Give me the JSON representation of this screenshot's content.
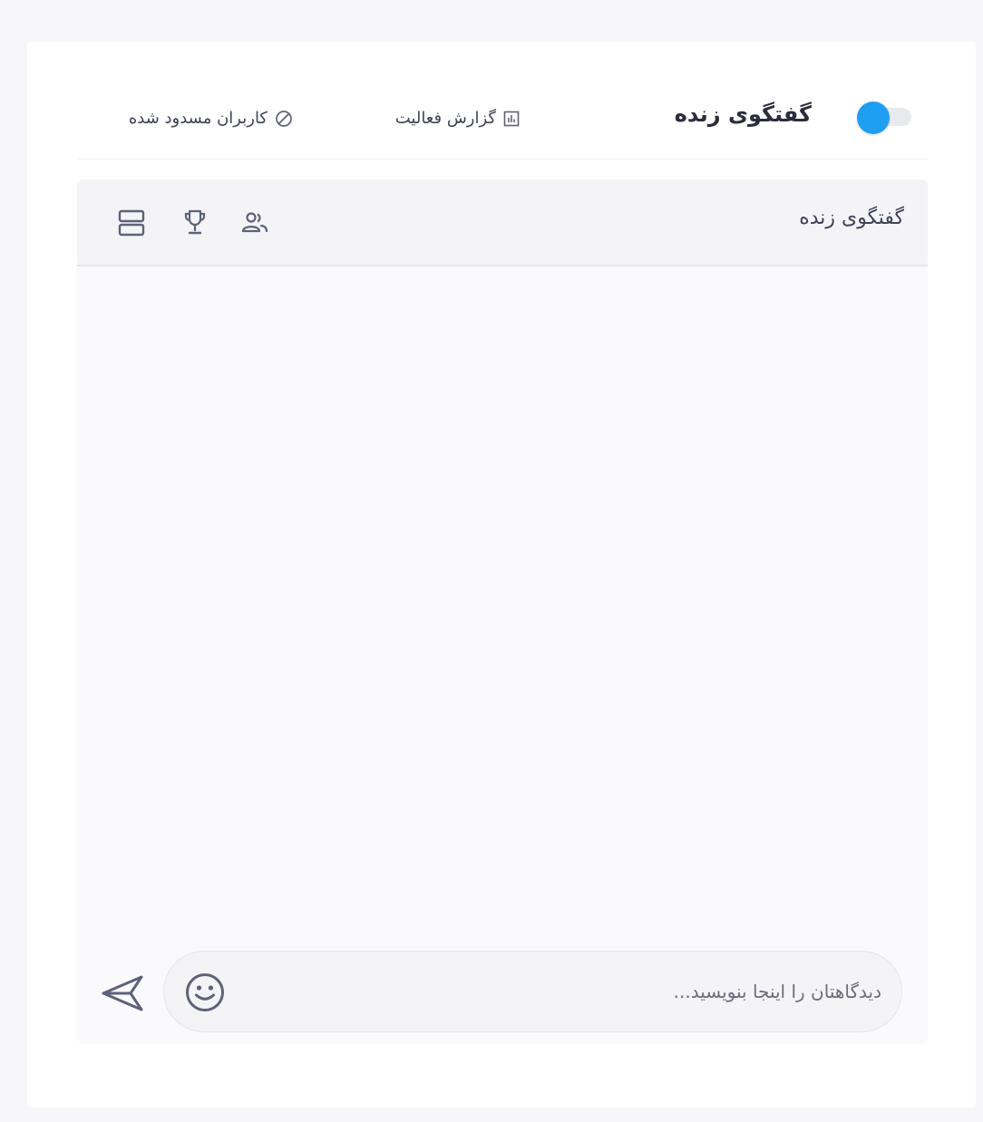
{
  "header": {
    "toggle_title": "گفتگوی زنده",
    "toggle_state": "on",
    "links": {
      "report_label": "گزارش فعالیت",
      "blocked_label": "کاربران مسدود شده"
    }
  },
  "chat": {
    "title": "گفتگوی زنده",
    "header_icons": [
      "users-icon",
      "trophy-icon",
      "layout-rows-icon"
    ],
    "composer": {
      "placeholder": "دیدگاهتان را اینجا بنویسید...",
      "value": ""
    },
    "emoji_icon": "smile-icon",
    "send_icon": "send-icon"
  },
  "colors": {
    "accent": "#1e9ff2",
    "page_bg": "#f7f7f9",
    "card_bg": "#ffffff",
    "chat_bg": "#fafafd",
    "chat_header_bg": "#f4f4f7",
    "icon": "#5e6278"
  }
}
